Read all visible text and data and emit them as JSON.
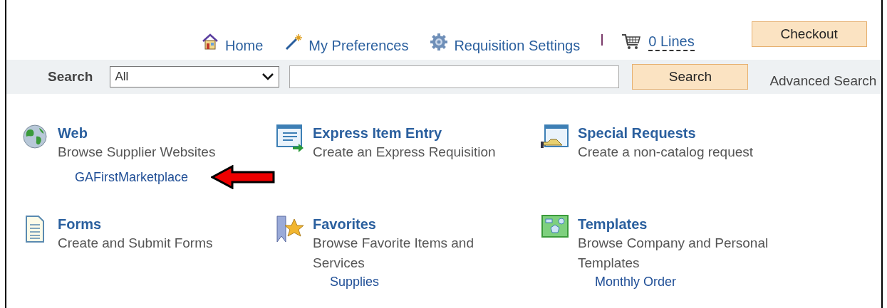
{
  "nav": [
    {
      "label": "Home"
    },
    {
      "label": "My Preferences"
    },
    {
      "label": "Requisition Settings"
    }
  ],
  "cart": {
    "label": "0 Lines"
  },
  "checkout_button": "Checkout",
  "search": {
    "label": "Search",
    "scope": "All",
    "button": "Search",
    "advanced_link": "Advanced Search"
  },
  "tiles": [
    {
      "title": "Web",
      "description": "Browse Supplier Websites",
      "link": "GAFirstMarketplace",
      "arrow": true
    },
    {
      "title": "Express Item Entry",
      "description": "Create an Express Requisition"
    },
    {
      "title": "Special Requests",
      "description": "Create a non-catalog request"
    },
    {
      "title": "Forms",
      "description": "Create and Submit Forms"
    },
    {
      "title": "Favorites",
      "description": "Browse Favorite Items and Services",
      "link": "Supplies"
    },
    {
      "title": "Templates",
      "description": "Browse Company and Personal Templates",
      "link": "Monthly Order"
    }
  ]
}
